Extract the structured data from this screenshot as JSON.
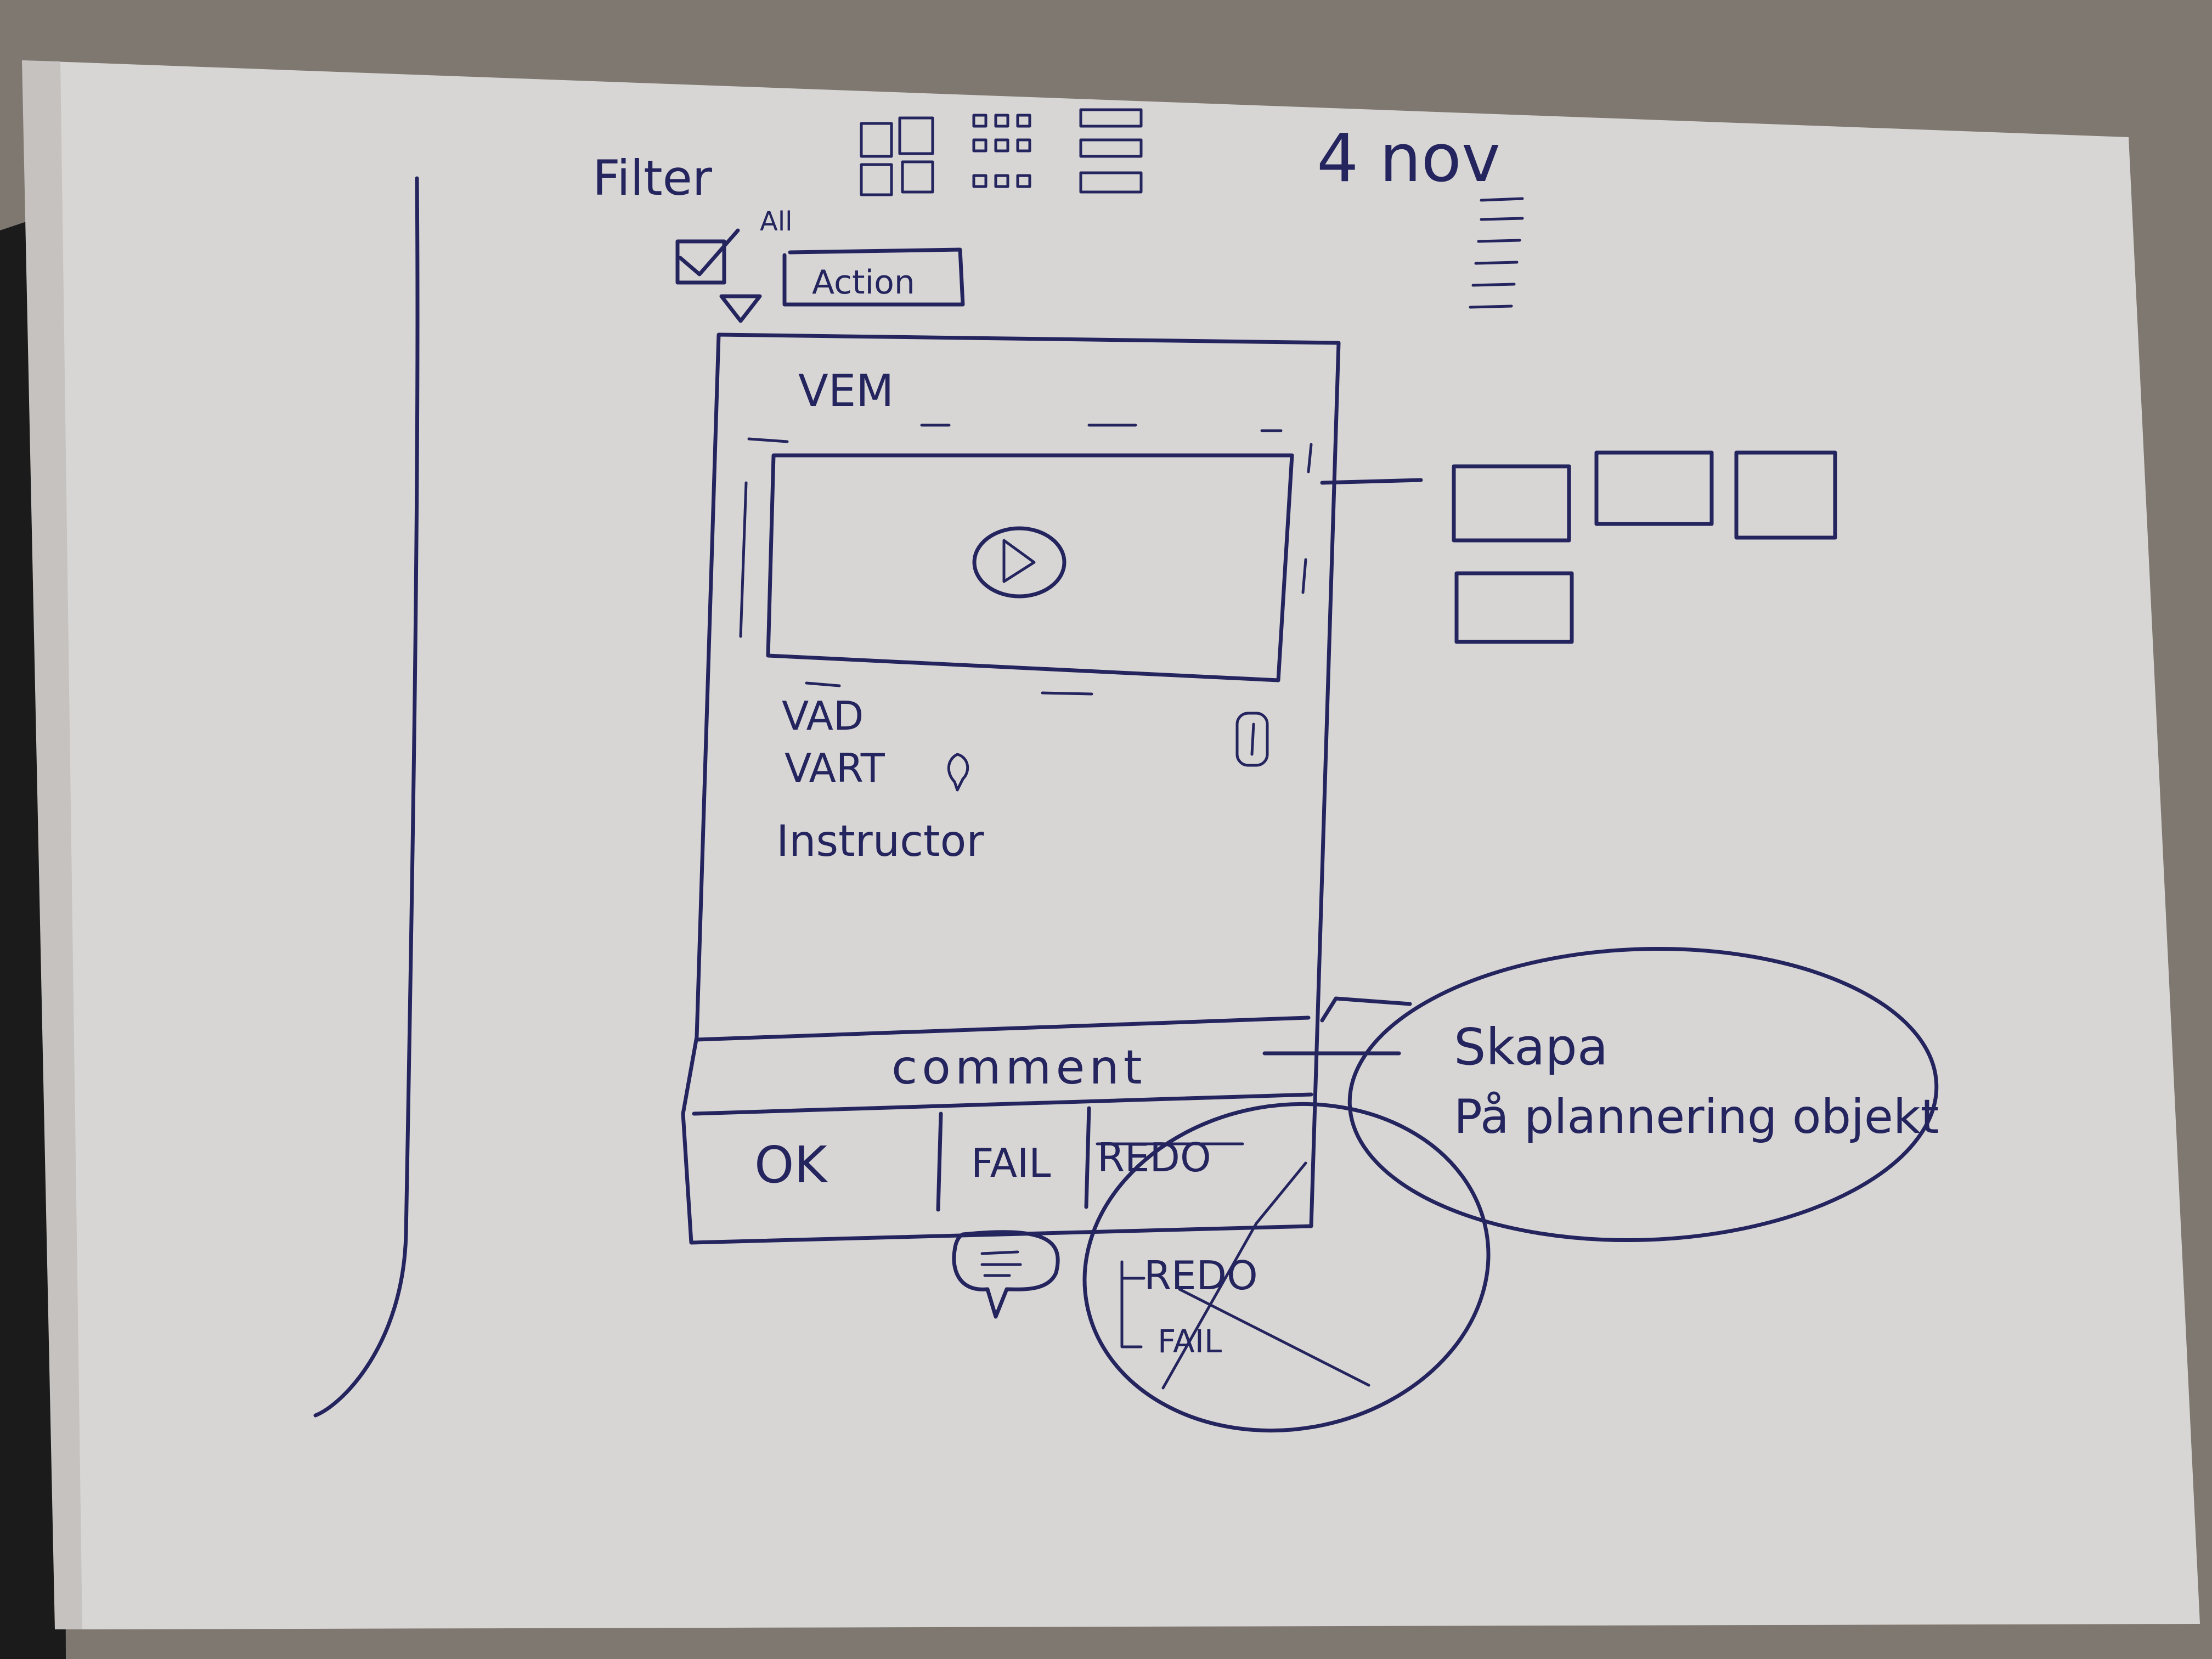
{
  "colors": {
    "table": "#7e7870",
    "paper": "#d8d6d4",
    "ink": "#24245e",
    "binder": "#1b1b1c"
  },
  "header": {
    "filter_label": "Filter",
    "all_label": "All",
    "action_label": "Action",
    "date_label": "4 nov"
  },
  "card": {
    "who_label": "VEM",
    "what_label": "VAD",
    "where_label": "VART",
    "instructor_label": "Instructor",
    "comment_label": "comment",
    "buttons": {
      "ok": "OK",
      "fail": "FAIL",
      "redo": "REDO"
    }
  },
  "popup": {
    "redo": "REDO",
    "fail": "FAIL"
  },
  "note": {
    "line1": "Skapa",
    "line2": "På plannering objekt"
  }
}
